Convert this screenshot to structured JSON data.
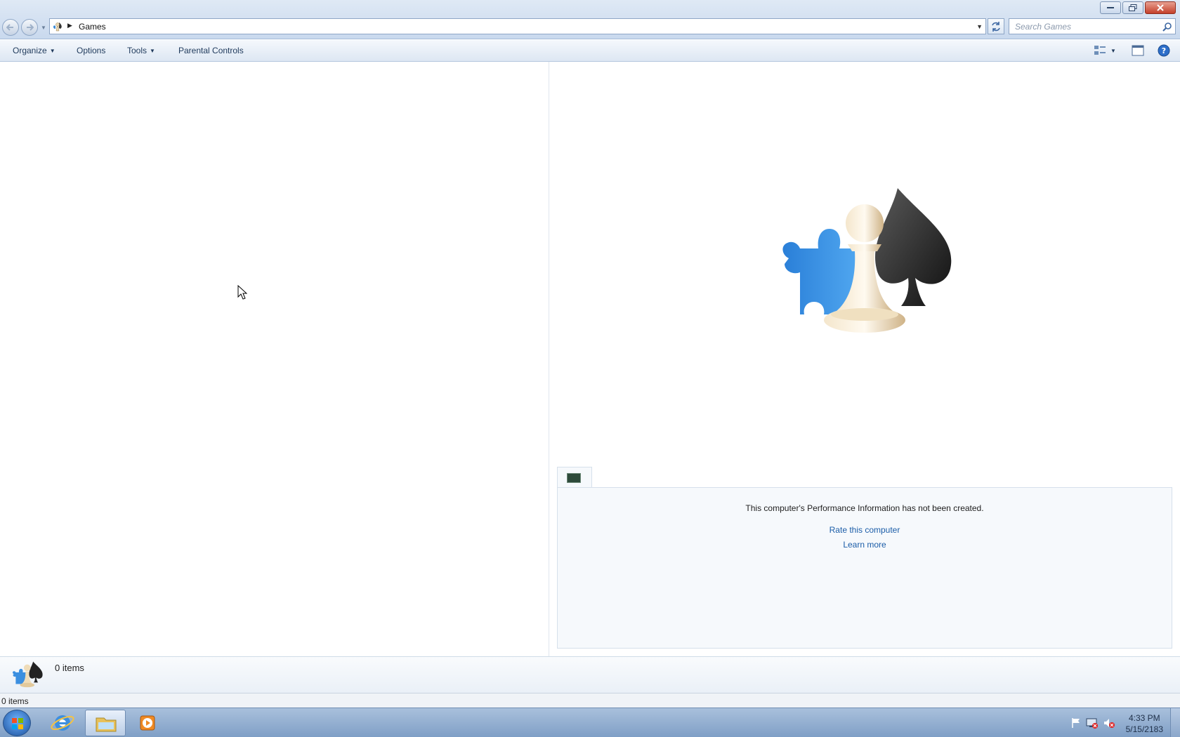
{
  "window": {
    "title": "Games",
    "address_crumb": "Games",
    "search_placeholder": "Search Games",
    "controls": {
      "minimize": "minimize",
      "maximize": "maximize",
      "close": "close"
    }
  },
  "toolbar": {
    "organize_label": "Organize",
    "options_label": "Options",
    "tools_label": "Tools",
    "parental_controls_label": "Parental Controls"
  },
  "performance": {
    "message": "This computer's Performance Information has not been created.",
    "rate_link": "Rate this computer",
    "learn_link": "Learn more"
  },
  "details": {
    "count": "0 items"
  },
  "status": {
    "count": "0 items"
  },
  "taskbar": {
    "clock_time": "4:33 PM",
    "clock_date": "5/15/2183",
    "pinned": [
      "internet-explorer",
      "windows-explorer",
      "media-player"
    ]
  },
  "colors": {
    "link": "#1b5da8",
    "titlebar": "#c9d9ee",
    "taskbar": "#7f9fc6"
  }
}
